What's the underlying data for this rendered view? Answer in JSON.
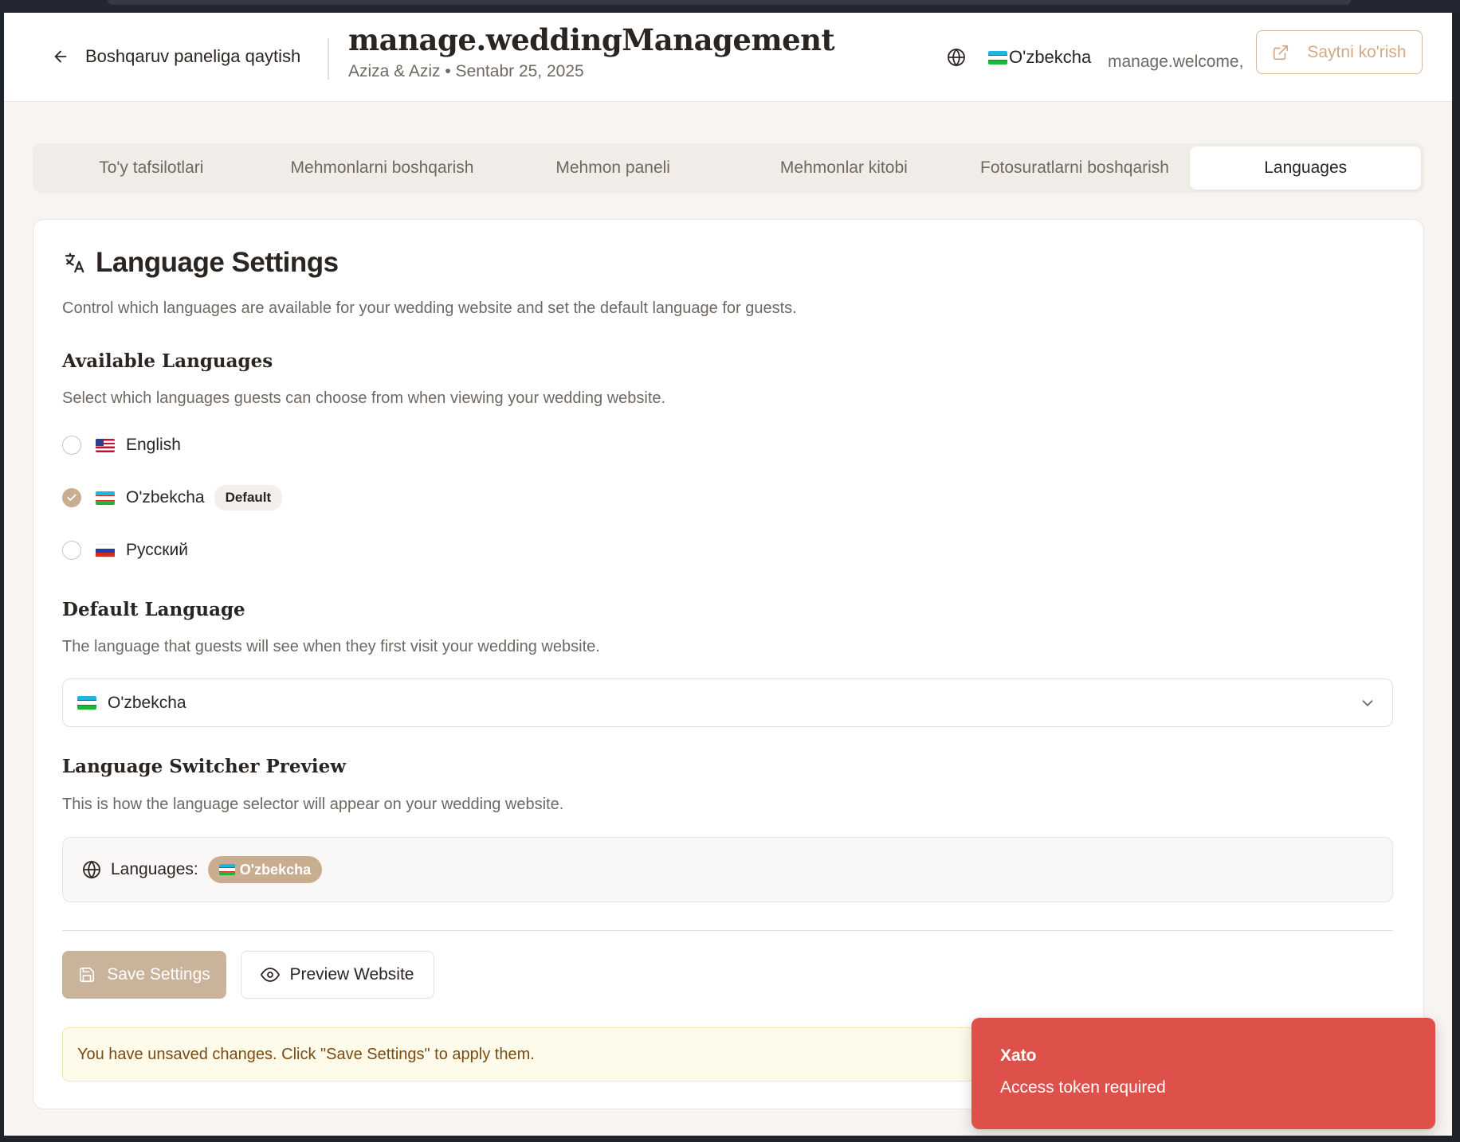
{
  "header": {
    "back_label": "Boshqaruv paneliga qaytish",
    "title": "manage.weddingManagement",
    "subtitle": "Aziza & Aziz • Sentabr 25, 2025",
    "language_label": "O'zbekcha",
    "welcome": "manage.welcome,",
    "view_site_label": "Saytni ko'rish"
  },
  "tabs": [
    {
      "label": "To'y tafsilotlari",
      "active": false
    },
    {
      "label": "Mehmonlarni boshqarish",
      "active": false
    },
    {
      "label": "Mehmon paneli",
      "active": false
    },
    {
      "label": "Mehmonlar kitobi",
      "active": false
    },
    {
      "label": "Fotosuratlarni boshqarish",
      "active": false
    },
    {
      "label": "Languages",
      "active": true
    }
  ],
  "settings": {
    "title": "Language Settings",
    "description": "Control which languages are available for your wedding website and set the default language for guests.",
    "available": {
      "heading": "Available Languages",
      "description": "Select which languages guests can choose from when viewing your wedding website.",
      "options": [
        {
          "label": "English",
          "checked": false,
          "flag": "us"
        },
        {
          "label": "O'zbekcha",
          "checked": true,
          "flag": "uz",
          "badge": "Default"
        },
        {
          "label": "Русский",
          "checked": false,
          "flag": "ru"
        }
      ]
    },
    "default": {
      "heading": "Default Language",
      "description": "The language that guests will see when they first visit your wedding website.",
      "selected": "O'zbekcha"
    },
    "preview": {
      "heading": "Language Switcher Preview",
      "description": "This is how the language selector will appear on your wedding website.",
      "label": "Languages:",
      "chip": "O'zbekcha"
    },
    "save_label": "Save Settings",
    "preview_label": "Preview Website",
    "unsaved_warning": "You have unsaved changes. Click \"Save Settings\" to apply them."
  },
  "toast": {
    "title": "Xato",
    "message": "Access token required"
  },
  "colors": {
    "accent": "#c9ad8f",
    "error": "#de514a",
    "background": "#f7f4f1"
  }
}
